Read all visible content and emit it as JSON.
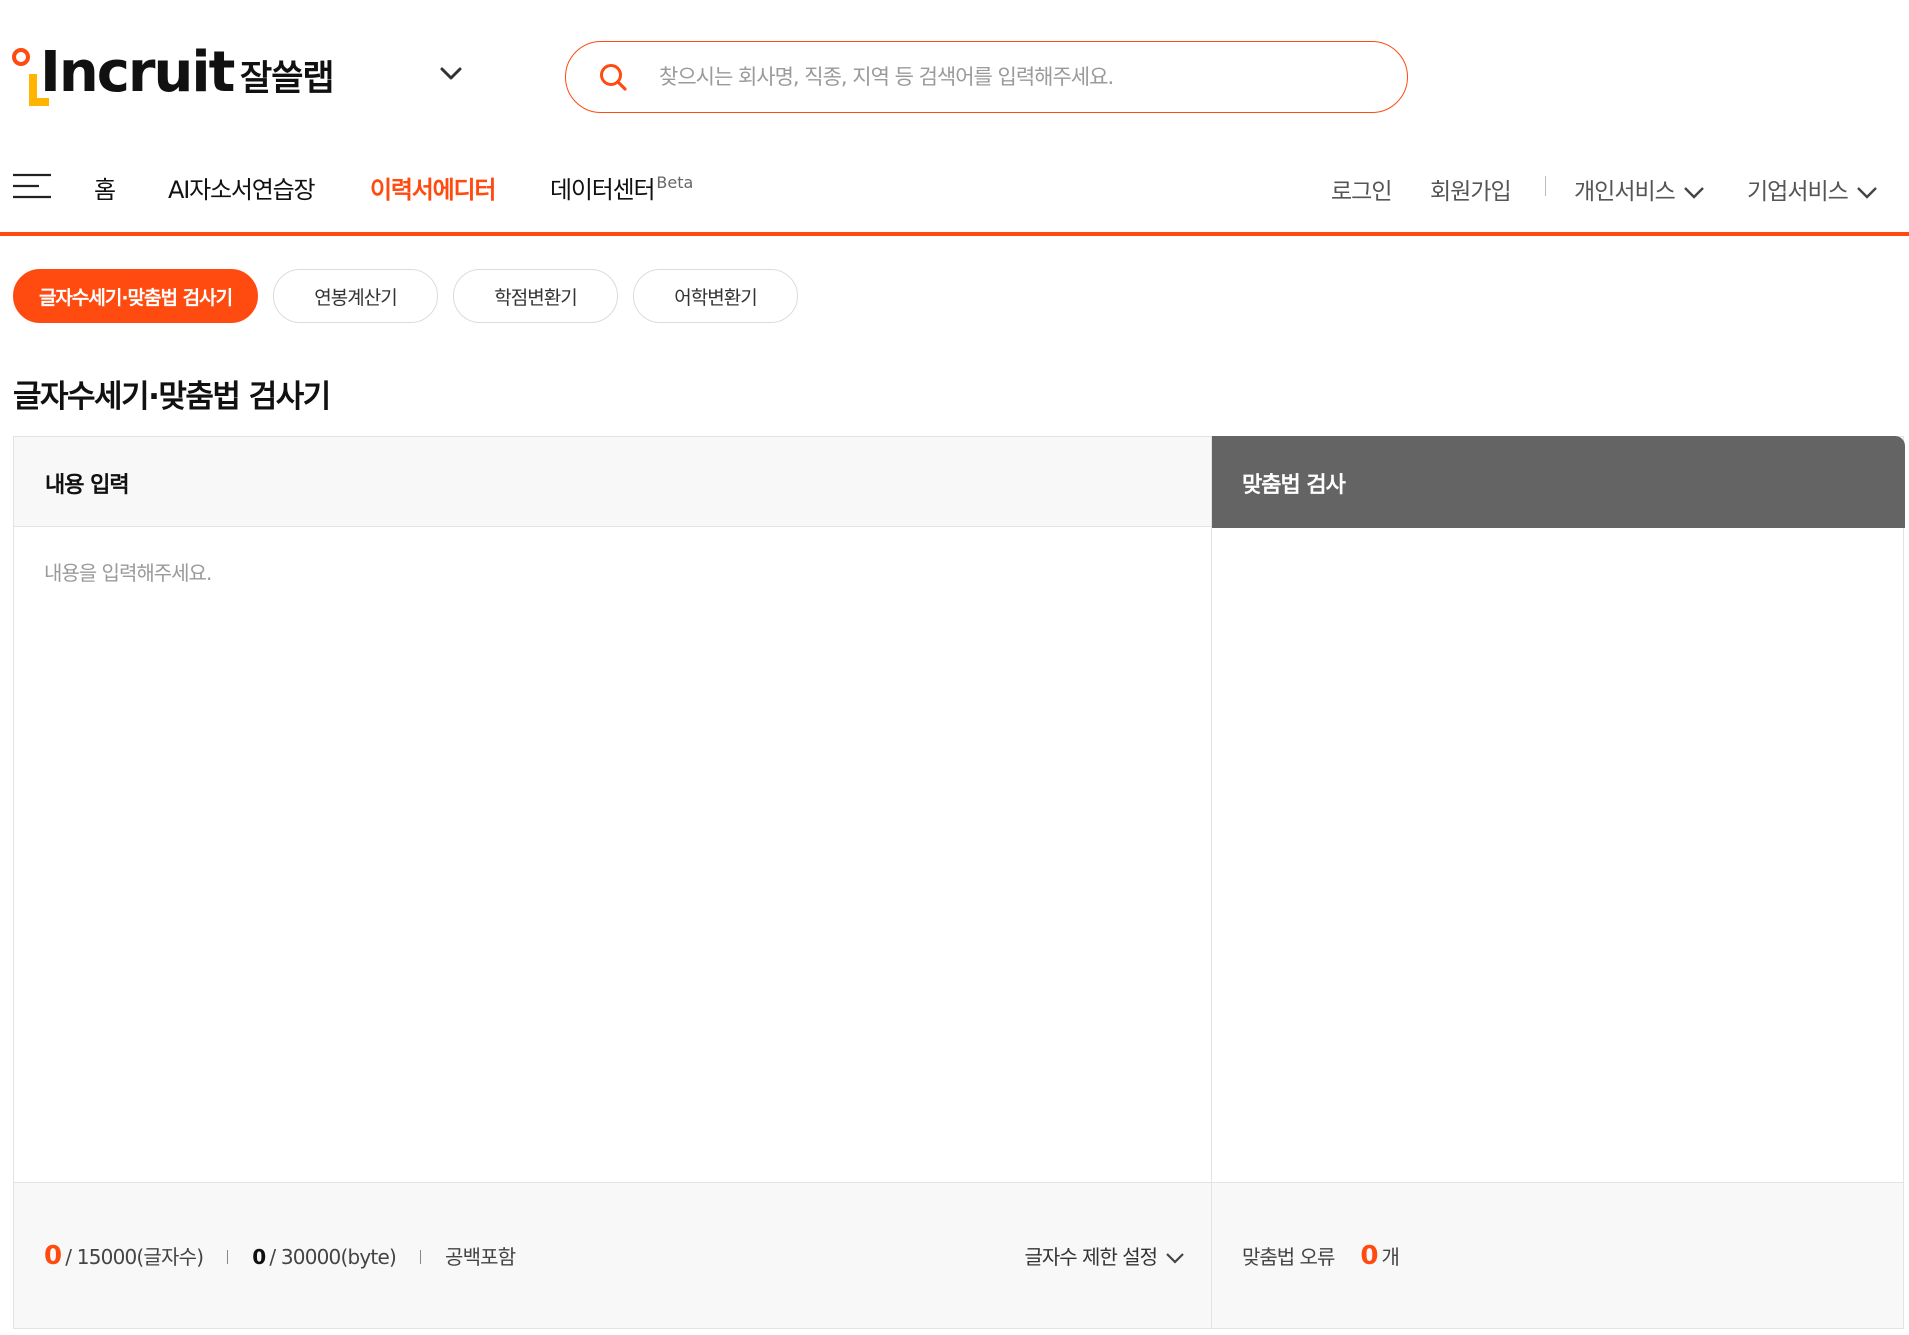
{
  "header": {
    "logo_text": "Incruit",
    "lab_title": "잘쓸랩",
    "search_placeholder": "찾으시는 회사명, 직종, 지역 등 검색어를 입력해주세요."
  },
  "nav": {
    "items": [
      {
        "label": "홈"
      },
      {
        "label": "AI자소서연습장"
      },
      {
        "label": "이력서에디터",
        "active": true
      },
      {
        "label": "데이터센터",
        "badge": "Beta"
      }
    ],
    "login": "로그인",
    "signup": "회원가입",
    "personal_service": "개인서비스",
    "company_service": "기업서비스"
  },
  "tabs": [
    {
      "label": "글자수세기·맞춤법 검사기",
      "active": true
    },
    {
      "label": "연봉계산기"
    },
    {
      "label": "학점변환기"
    },
    {
      "label": "어학변환기"
    }
  ],
  "page_title": "글자수세기·맞춤법 검사기",
  "input_panel": {
    "title": "내용 입력",
    "placeholder": "내용을 입력해주세요.",
    "char_count": "0",
    "char_limit": "/ 15000(글자수)",
    "byte_count": "0",
    "byte_limit": "/ 30000(byte)",
    "space_option": "공백포함",
    "limit_setting": "글자수 제한 설정"
  },
  "spell_panel": {
    "title": "맞춤법 검사",
    "error_label": "맞춤법 오류",
    "error_count": "0",
    "error_unit": "개"
  },
  "colors": {
    "accent": "#ff4a10",
    "logo_yellow": "#ffb400",
    "spell_header": "#646464"
  }
}
